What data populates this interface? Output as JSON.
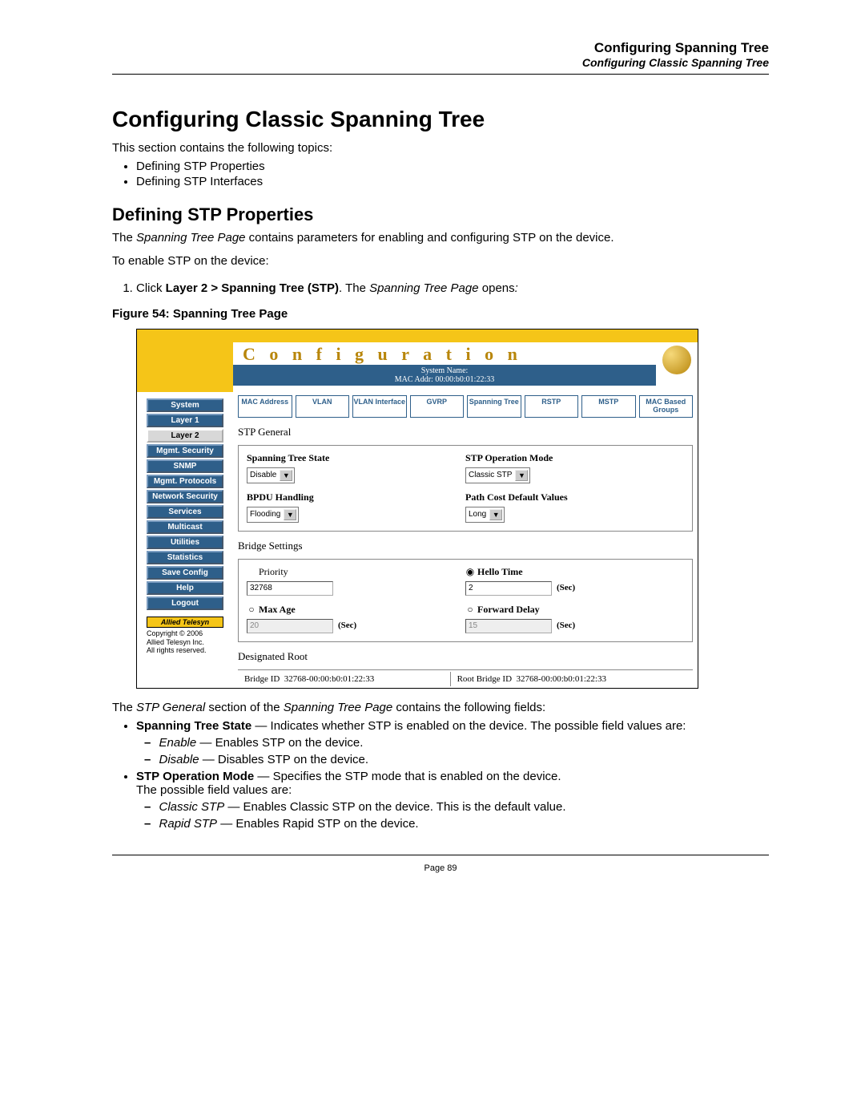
{
  "header": {
    "line1": "Configuring Spanning Tree",
    "line2": "Configuring Classic Spanning Tree"
  },
  "h1": "Configuring Classic Spanning Tree",
  "intro": "This section contains the following topics:",
  "topics": [
    "Defining STP Properties",
    "Defining STP Interfaces"
  ],
  "h2": "Defining STP Properties",
  "para1_pre": "The ",
  "para1_em": "Spanning Tree Page",
  "para1_post": " contains parameters for enabling and configuring STP on the device.",
  "para2": "To enable STP on the device:",
  "step1_pre": "Click ",
  "step1_bold": "Layer 2 > Spanning Tree (STP)",
  "step1_mid": ". The ",
  "step1_em": "Spanning Tree Page",
  "step1_post": " opens",
  "step1_colon": ":",
  "fig_caption": "Figure 54:  Spanning Tree Page",
  "screenshot": {
    "title": "C o n f i g u r a t i o n",
    "sys_name": "System Name:",
    "mac_addr": "MAC Addr:  00:00:b0:01:22:33",
    "sidebar": [
      "System",
      "Layer 1",
      "Layer 2",
      "Mgmt. Security",
      "SNMP",
      "Mgmt. Protocols",
      "Network Security",
      "Services",
      "Multicast",
      "Utilities",
      "Statistics",
      "Save Config",
      "Help",
      "Logout"
    ],
    "sidebar_light_index": 2,
    "side_logo": "Allied Telesyn",
    "side_copy": [
      "Copyright © 2006",
      "Allied Telesyn Inc.",
      "All rights reserved."
    ],
    "tabs": [
      "MAC Address",
      "VLAN",
      "VLAN Interface",
      "GVRP",
      "Spanning Tree",
      "RSTP",
      "MSTP",
      "MAC Based Groups"
    ],
    "sec1_title": "STP General",
    "lbl_state": "Spanning Tree State",
    "val_state": "Disable",
    "lbl_mode": "STP Operation Mode",
    "val_mode": "Classic STP",
    "lbl_bpdu": "BPDU Handling",
    "val_bpdu": "Flooding",
    "lbl_path": "Path Cost Default Values",
    "val_path": "Long",
    "sec2_title": "Bridge Settings",
    "lbl_priority": "Priority",
    "val_priority": "32768",
    "lbl_hello": "Hello Time",
    "val_hello": "2",
    "lbl_maxage": "Max Age",
    "val_maxage": "20",
    "lbl_fwd": "Forward Delay",
    "val_fwd": "15",
    "unit_sec": "(Sec)",
    "sec3_title": "Designated Root",
    "lbl_bridgeid": "Bridge ID",
    "val_bridgeid": "32768-00:00:b0:01:22:33",
    "lbl_rootid": "Root Bridge ID",
    "val_rootid": "32768-00:00:b0:01:22:33"
  },
  "after_fig_pre": "The ",
  "after_fig_em1": "STP General",
  "after_fig_mid": " section of the ",
  "after_fig_em2": "Spanning Tree Page",
  "after_fig_post": " contains the following fields:",
  "field1_name": "Spanning Tree State",
  "field1_desc": " — Indicates whether STP is enabled on the device. The possible field values are:",
  "field1_sub1_em": "Enable",
  "field1_sub1_txt": " — Enables STP on the device.",
  "field1_sub2_em": "Disable",
  "field1_sub2_txt": " — Disables STP on the device.",
  "field2_name": "STP Operation Mode",
  "field2_desc_line1": " — Specifies the STP mode that is enabled on the device.",
  "field2_desc_line2": "The possible field values are:",
  "field2_sub1_em": "Classic STP",
  "field2_sub1_txt": " — Enables Classic STP on the device. This is the default value.",
  "field2_sub2_em": "Rapid STP",
  "field2_sub2_txt": " — Enables Rapid STP on the device.",
  "page_num": "Page 89"
}
